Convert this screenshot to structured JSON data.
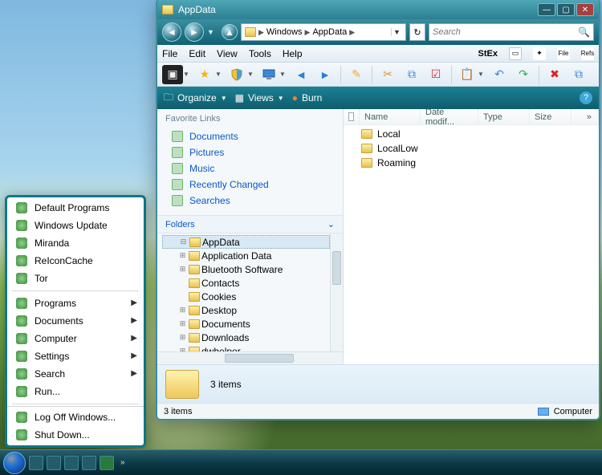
{
  "taskbar": {
    "more": "»"
  },
  "start_menu": {
    "items_top": [
      {
        "label": "Default Programs",
        "icon": "defaults"
      },
      {
        "label": "Windows Update",
        "icon": "update"
      },
      {
        "label": "Miranda",
        "icon": "miranda"
      },
      {
        "label": "ReIconCache",
        "icon": "reicon"
      },
      {
        "label": "Tor",
        "icon": "tor"
      }
    ],
    "items_mid": [
      {
        "label": "Programs",
        "arrow": true
      },
      {
        "label": "Documents",
        "arrow": true
      },
      {
        "label": "Computer",
        "arrow": true
      },
      {
        "label": "Settings",
        "arrow": true
      },
      {
        "label": "Search",
        "arrow": true
      },
      {
        "label": "Run...",
        "arrow": false
      }
    ],
    "items_bottom": [
      {
        "label": "Log Off Windows..."
      },
      {
        "label": "Shut Down..."
      }
    ]
  },
  "explorer": {
    "title": "AppData",
    "breadcrumb": [
      "Windows",
      "AppData"
    ],
    "search_placeholder": "Search",
    "menubar": [
      "File",
      "Edit",
      "View",
      "Tools",
      "Help"
    ],
    "stex": "StEx",
    "cmdbar": {
      "organize": "Organize",
      "views": "Views",
      "burn": "Burn"
    },
    "fav_head": "Favorite Links",
    "favorites": [
      "Documents",
      "Pictures",
      "Music",
      "Recently Changed",
      "Searches"
    ],
    "folders_head": "Folders",
    "tree": [
      {
        "label": "AppData",
        "sel": true,
        "exp": "-"
      },
      {
        "label": "Application Data",
        "exp": "+"
      },
      {
        "label": "Bluetooth Software",
        "exp": "+"
      },
      {
        "label": "Contacts",
        "exp": ""
      },
      {
        "label": "Cookies",
        "exp": ""
      },
      {
        "label": "Desktop",
        "exp": "+"
      },
      {
        "label": "Documents",
        "exp": "+"
      },
      {
        "label": "Downloads",
        "exp": "+"
      },
      {
        "label": "dwhelper",
        "exp": "+"
      }
    ],
    "columns": {
      "name": "Name",
      "date": "Date modif...",
      "type": "Type",
      "size": "Size",
      "more": "»"
    },
    "rows": [
      "Local",
      "LocalLow",
      "Roaming"
    ],
    "details": "3 items",
    "status_left": "3 items",
    "status_right": "Computer"
  }
}
